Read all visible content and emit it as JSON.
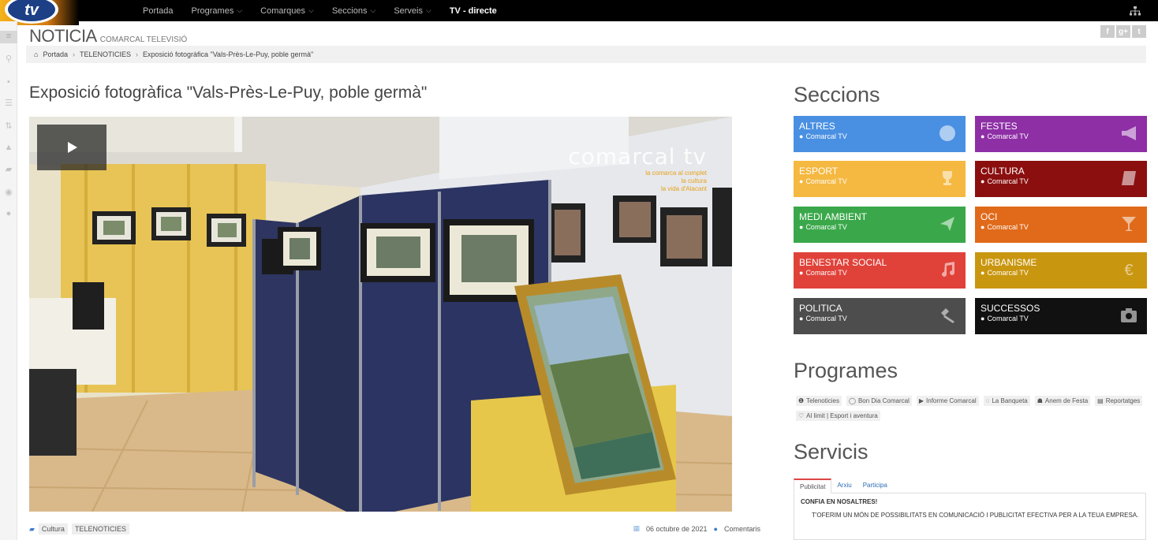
{
  "nav": {
    "logo_text": "tv",
    "items": [
      {
        "label": "Portada",
        "chevron": false
      },
      {
        "label": "Programes",
        "chevron": true
      },
      {
        "label": "Comarques",
        "chevron": true
      },
      {
        "label": "Seccions",
        "chevron": true
      },
      {
        "label": "Serveis",
        "chevron": true
      },
      {
        "label": "TV - directe",
        "chevron": false
      }
    ]
  },
  "header": {
    "section": "NOTICIA",
    "site": "COMARCAL TELEVISIÓ"
  },
  "social": [
    "f",
    "g+",
    "t"
  ],
  "breadcrumb": {
    "home": "Portada",
    "level1": "TELENOTICIES",
    "current": "Exposició fotogràfica \"Vals-Près-Le-Puy, poble germà\""
  },
  "article": {
    "title": "Exposició fotogràfica \"Vals-Près-Le-Puy, poble germà\"",
    "video_watermark": "comarcal tv",
    "watermark_lines": [
      "la comarca al complet",
      "la cultura",
      "la vida d'Alacant"
    ],
    "tags": [
      "Cultura",
      "TELENOTICIES"
    ],
    "date": "06 octubre de 2021",
    "comments": "Comentaris"
  },
  "sections": {
    "heading": "Seccions",
    "tiles": [
      {
        "name": "ALTRES",
        "sub": "Comarcal TV",
        "color": "#4a90e2",
        "icon": "globe-icon"
      },
      {
        "name": "FESTES",
        "sub": "Comarcal TV",
        "color": "#8e2fa6",
        "icon": "megaphone-icon"
      },
      {
        "name": "ESPORT",
        "sub": "Comarcal TV",
        "color": "#f5b840",
        "icon": "trophy-icon"
      },
      {
        "name": "CULTURA",
        "sub": "Comarcal TV",
        "color": "#8b0f0f",
        "icon": "book-icon"
      },
      {
        "name": "MEDI AMBIENT",
        "sub": "Comarcal TV",
        "color": "#3aa84a",
        "icon": "plane-icon"
      },
      {
        "name": "OCI",
        "sub": "Comarcal TV",
        "color": "#e06a1a",
        "icon": "glass-icon"
      },
      {
        "name": "BENESTAR SOCIAL",
        "sub": "Comarcal TV",
        "color": "#e0423a",
        "icon": "music-icon"
      },
      {
        "name": "URBANISME",
        "sub": "Comarcal TV",
        "color": "#c9960f",
        "icon": "euro-icon"
      },
      {
        "name": "POLITICA",
        "sub": "Comarcal TV",
        "color": "#4d4d4d",
        "icon": "gavel-icon"
      },
      {
        "name": "SUCCESSOS",
        "sub": "Comarcal TV",
        "color": "#111111",
        "icon": "camera-icon"
      }
    ]
  },
  "programes": {
    "heading": "Programes",
    "items": [
      {
        "icon": "info-icon",
        "glyph": "❶",
        "label": "Telenoticies"
      },
      {
        "icon": "clock-icon",
        "glyph": "◯",
        "label": "Bon Dia Comarcal"
      },
      {
        "icon": "play-icon",
        "glyph": "▶",
        "label": "Informe Comarcal"
      },
      {
        "icon": "chat-icon",
        "glyph": "◌",
        "label": "La Banqueta"
      },
      {
        "icon": "people-icon",
        "glyph": "☗",
        "label": "Anem de Festa"
      },
      {
        "icon": "film-icon",
        "glyph": "▤",
        "label": "Reportatges"
      },
      {
        "icon": "heart-icon",
        "glyph": "♡",
        "label": "Al limit | Esport i aventura"
      }
    ]
  },
  "servicis": {
    "heading": "Servicis",
    "tabs": [
      "Publicitat",
      "Arxiu",
      "Participa"
    ],
    "panel_title": "CONFIA EN NOSALTRES!",
    "panel_text": "T'OFERIM UN MÓN DE POSSIBILITATS EN COMUNICACIÓ I PUBLICITAT EFECTIVA PER A LA TEUA EMPRESA."
  }
}
